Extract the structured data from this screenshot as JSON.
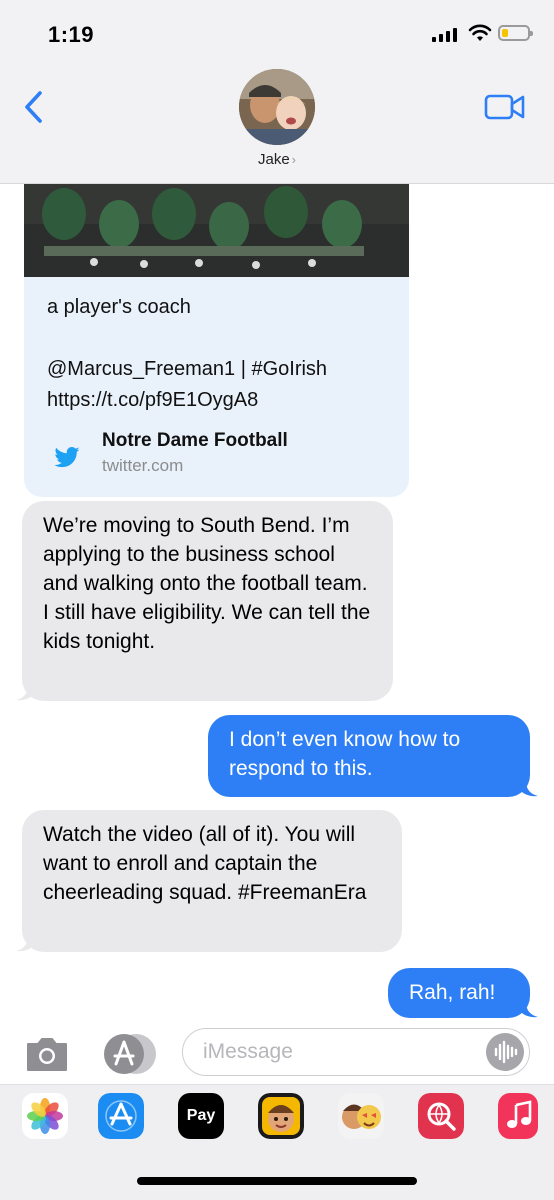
{
  "status_bar": {
    "time": "1:19",
    "battery_level": 0.15
  },
  "header": {
    "contact_name": "Jake",
    "chevron": "›"
  },
  "link_preview": {
    "text": "a player's coach\n\n@Marcus_Freeman1 | #GoIrish\nhttps://t.co/pf9E1OygA8",
    "source_title": "Notre Dame Football",
    "source_domain": "twitter.com",
    "source_icon": "twitter-bird-icon"
  },
  "messages": [
    {
      "direction": "incoming",
      "text": "We’re moving to South Bend. I’m applying to the business school and walking onto the football team. I still have eligibility. We can tell the kids tonight."
    },
    {
      "direction": "outgoing",
      "text": "I don’t even know how to respond to this."
    },
    {
      "direction": "incoming",
      "text": "Watch the video (all of it). You will want to enroll and captain the cheerleading squad. #FreemanEra"
    },
    {
      "direction": "outgoing",
      "text": "Rah, rah!"
    }
  ],
  "input": {
    "placeholder": "iMessage"
  },
  "app_drawer": {
    "apps": [
      "photos-icon",
      "app-store-icon",
      "apple-pay-icon",
      "memoji-icon",
      "animoji-stickers-icon",
      "web-search-icon",
      "music-icon"
    ],
    "apple_pay_label": "Pay"
  },
  "colors": {
    "outgoing_bubble": "#2e7ff6",
    "incoming_bubble": "#e9e9eb",
    "accent": "#2e7ff6"
  }
}
